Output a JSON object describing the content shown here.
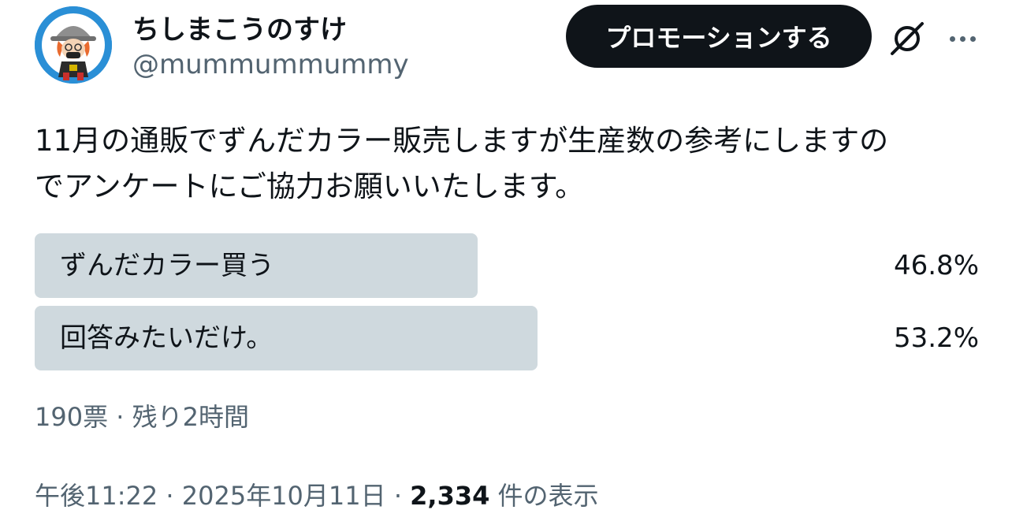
{
  "user": {
    "display_name": "ちしまこうのすけ",
    "handle": "@mummummummy"
  },
  "header": {
    "promote_label": "プロモーションする",
    "icons": [
      "grok-icon",
      "more-icon"
    ]
  },
  "tweet": {
    "text_line_1": "11月の通販でずんだカラー販売しますが生産数の参考にしますの",
    "text_line_2": "でアンケートにご協力お願いいたします。"
  },
  "poll": {
    "options": [
      {
        "label": "ずんだカラー買う",
        "percent_text": "46.8%",
        "percent": 46.8
      },
      {
        "label": "回答みたいだけ。",
        "percent_text": "53.2%",
        "percent": 53.2
      }
    ],
    "meta": "190票 · 残り2時間"
  },
  "footer": {
    "time": "午後11:22",
    "sep1": " · ",
    "date": "2025年10月11日",
    "sep2": " · ",
    "views_count": "2,334",
    "views_label": " 件の表示"
  },
  "colors": {
    "poll_bar": "#cfd9de",
    "button_bg": "#0f1419",
    "secondary_text": "#536471",
    "avatar_bg": "#2a8fd6"
  }
}
